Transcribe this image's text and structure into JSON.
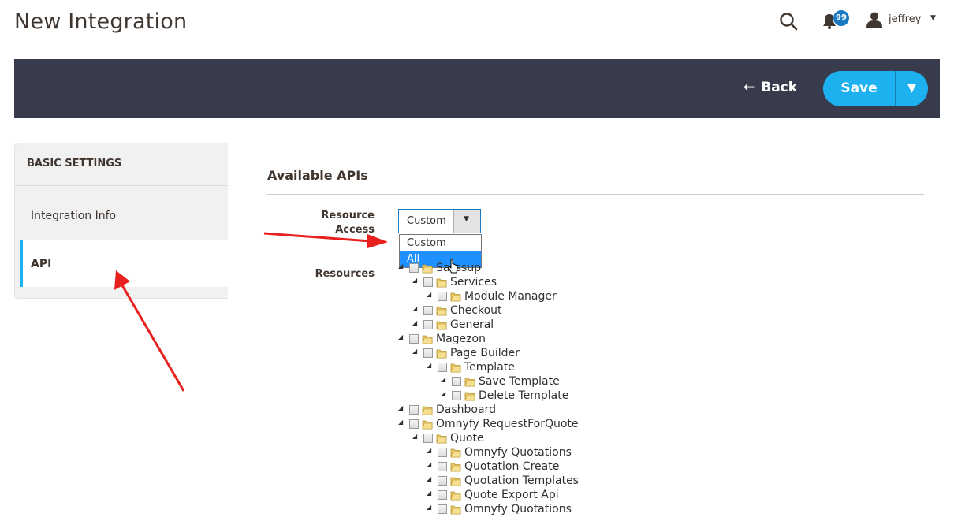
{
  "page": {
    "title": "New Integration"
  },
  "header": {
    "notifications_count": "99",
    "user_name": "jeffrey",
    "icons": [
      "search-icon",
      "bell-icon",
      "user-icon",
      "chevron-down-icon"
    ]
  },
  "action_bar": {
    "back_label": "Back",
    "save_label": "Save"
  },
  "sidebar": {
    "heading": "BASIC SETTINGS",
    "items": [
      {
        "label": "Integration Info",
        "active": false
      },
      {
        "label": "API",
        "active": true
      }
    ]
  },
  "main": {
    "section_title": "Available APIs",
    "resource_access": {
      "label": "Resource Access",
      "selected": "Custom",
      "options": [
        "Custom",
        "All"
      ],
      "highlighted": "All"
    },
    "resources_label": "Resources",
    "tree": [
      {
        "label": "Sasssup",
        "level": 0
      },
      {
        "label": "Services",
        "level": 1
      },
      {
        "label": "Module Manager",
        "level": 2
      },
      {
        "label": "Checkout",
        "level": 1
      },
      {
        "label": "General",
        "level": 1
      },
      {
        "label": "Magezon",
        "level": 0
      },
      {
        "label": "Page Builder",
        "level": 1
      },
      {
        "label": "Template",
        "level": 2
      },
      {
        "label": "Save Template",
        "level": 3
      },
      {
        "label": "Delete Template",
        "level": 3
      },
      {
        "label": "Dashboard",
        "level": 0
      },
      {
        "label": "Omnyfy RequestForQuote",
        "level": 0
      },
      {
        "label": "Quote",
        "level": 1
      },
      {
        "label": "Omnyfy Quotations",
        "level": 2
      },
      {
        "label": "Quotation Create",
        "level": 2
      },
      {
        "label": "Quotation Templates",
        "level": 2
      },
      {
        "label": "Quote Export Api",
        "level": 2
      },
      {
        "label": "Omnyfy Quotations",
        "level": 2
      }
    ]
  },
  "colors": {
    "action_bar_bg": "#373b4c",
    "save_button": "#1db1f0",
    "nav_active_border": "#1db1f0",
    "dropdown_highlight": "#1e90ff",
    "annotation_arrow": "#e8211f"
  }
}
